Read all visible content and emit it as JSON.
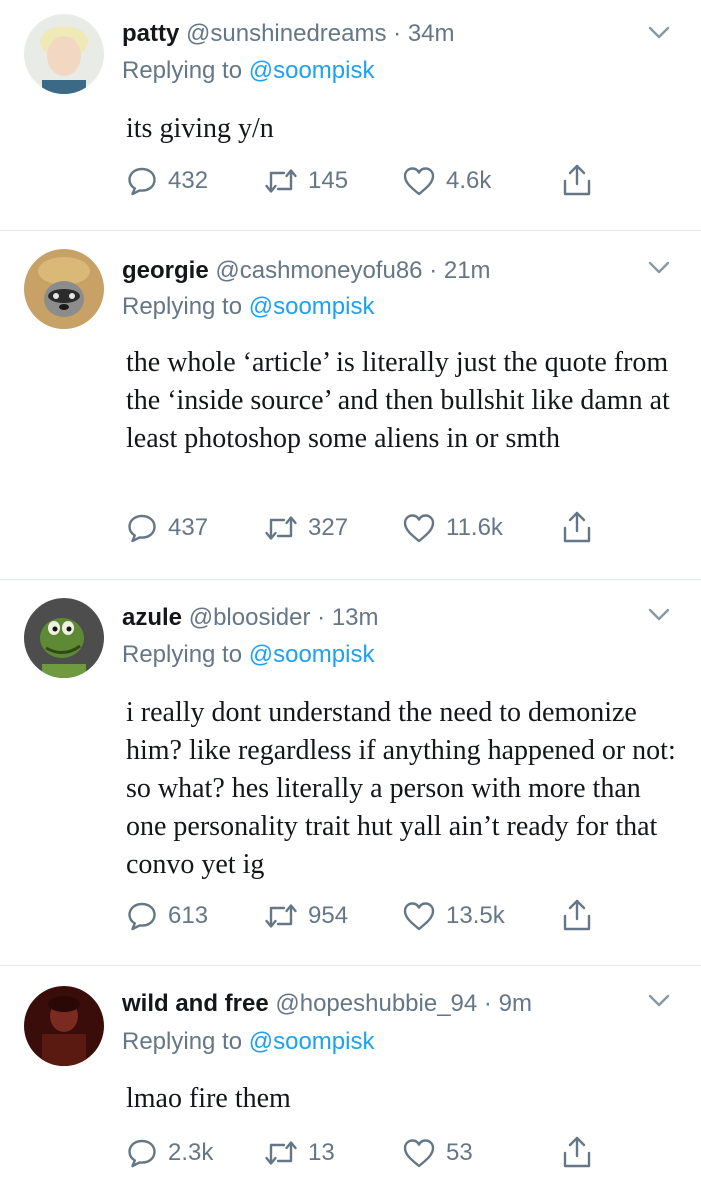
{
  "tweets": [
    {
      "name": "patty",
      "handle": "@sunshinedreams",
      "separator": "·",
      "time": "34m",
      "replying_prefix": "Replying to",
      "replying_handle": "@soompisk",
      "text": "its giving y/n",
      "replies": "432",
      "retweets": "145",
      "likes": "4.6k"
    },
    {
      "name": "georgie",
      "handle": "@cashmoneyofu86",
      "separator": "·",
      "time": "21m",
      "replying_prefix": "Replying to",
      "replying_handle": "@soompisk",
      "text": "the whole ‘article’ is literally just the quote from the ‘inside source’ and then bullshit like damn at least photoshop some aliens in or smth",
      "replies": "437",
      "retweets": "327",
      "likes": "11.6k"
    },
    {
      "name": "azule",
      "handle": "@bloosider",
      "separator": "·",
      "time": "13m",
      "replying_prefix": "Replying to",
      "replying_handle": "@soompisk",
      "text": "i really dont understand the need to demonize him? like regardless if anything happened or not: so what? hes literally a person with more than one personality trait hut yall ain’t ready for that convo yet ig",
      "replies": "613",
      "retweets": "954",
      "likes": "13.5k"
    },
    {
      "name": "wild and free",
      "handle": "@hopeshubbie_94",
      "separator": "·",
      "time": "9m",
      "replying_prefix": "Replying to",
      "replying_handle": "@soompisk",
      "text": "lmao fire them",
      "replies": "2.3k",
      "retweets": "13",
      "likes": "53"
    }
  ],
  "colors": {
    "text": "#14171a",
    "secondary": "#657786",
    "link": "#1da1f2",
    "divider": "#e1e8ed"
  },
  "icons": {
    "reply": "speech-bubble-icon",
    "retweet": "retweet-arrows-icon",
    "like": "heart-outline-icon",
    "share": "share-upload-icon",
    "more": "chevron-down-icon"
  }
}
